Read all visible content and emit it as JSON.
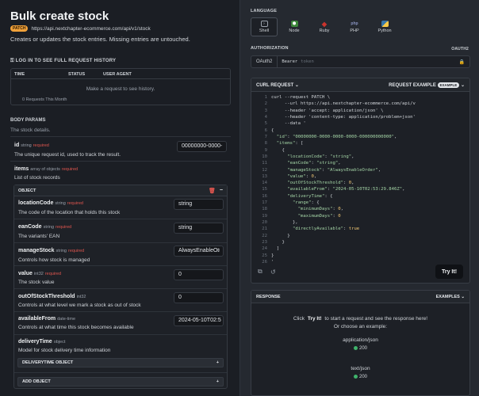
{
  "page": {
    "title": "Bulk create stock",
    "method": "PATCH",
    "url": "https://api.nextchapter-ecommerce.com/api/v1/stock",
    "description": "Creates or updates the stock entries. Missing entries are untouched."
  },
  "history": {
    "link_label": "LOG IN TO SEE FULL REQUEST HISTORY",
    "columns": [
      "TIME",
      "STATUS",
      "USER AGENT"
    ],
    "empty_message": "Make a request to see history.",
    "footer": "0 Requests This Month"
  },
  "body_params": {
    "label": "BODY PARAMS",
    "description": "The stock details.",
    "id": {
      "name": "id",
      "type": "string",
      "required": "required",
      "description": "The unique request id, used to track the result.",
      "value": "00000000-0000-"
    },
    "items": {
      "name": "items",
      "type": "array of objects",
      "required": "required",
      "description": "List of stock records",
      "object_label": "OBJECT",
      "fields": [
        {
          "name": "locationCode",
          "type": "string",
          "required": "required",
          "description": "The code of the location that holds this stock",
          "value": "string"
        },
        {
          "name": "eanCode",
          "type": "string",
          "required": "required",
          "description": "The variants' EAN",
          "value": "string"
        },
        {
          "name": "manageStock",
          "type": "string",
          "required": "required",
          "description": "Controls how stock is managed",
          "value": "AlwaysEnableO"
        },
        {
          "name": "value",
          "type": "int32",
          "required": "required",
          "description": "The stock value",
          "value": "0"
        },
        {
          "name": "outOfStockThreshold",
          "type": "int32",
          "required": "",
          "description": "Controls at what level we mark a stock as out of stock",
          "value": "0"
        },
        {
          "name": "availableFrom",
          "type": "date-time",
          "required": "",
          "description": "Controls at what time this stock becomes available",
          "value": "2024-05-10T02:5"
        },
        {
          "name": "deliveryTime",
          "type": "object",
          "required": "",
          "description": "Model for stock delivery time information",
          "value": ""
        }
      ],
      "delivery_object_label": "DELIVERYTIME OBJECT",
      "add_object_label": "ADD OBJECT",
      "plus": "+"
    }
  },
  "language": {
    "label": "LANGUAGE",
    "options": [
      {
        "label": "Shell",
        "icon": "shell-icon",
        "color": "#9aa1ab"
      },
      {
        "label": "Node",
        "icon": "node-icon",
        "color": "#6cc24a"
      },
      {
        "label": "Ruby",
        "icon": "ruby-icon",
        "color": "#cc342d"
      },
      {
        "label": "PHP",
        "icon": "php-icon",
        "color": "#8892bf"
      },
      {
        "label": "Python",
        "icon": "python-icon",
        "color": "#f7c948"
      }
    ]
  },
  "authorization": {
    "label": "AUTHORIZATION",
    "badge": "OAUTH2",
    "scheme": "OAuth2",
    "token_prefix": "Bearer",
    "token_placeholder": "token"
  },
  "request": {
    "curl_label": "CURL REQUEST",
    "example_label": "REQUEST EXAMPLE",
    "example_badge": "EXAMPLE",
    "lines": [
      "curl --request PATCH \\",
      "     --url https://api.nextchapter-ecommerce.com/api/v",
      "     --header 'accept: application/json' \\",
      "     --header 'content-type: application/problem+json'",
      "     --data '",
      "{",
      "  \"id\": \"00000000-0000-0000-0000-000000000000\",",
      "  \"items\": [",
      "    {",
      "      \"locationCode\": \"string\",",
      "      \"eanCode\": \"string\",",
      "      \"manageStock\": \"AlwaysEnableOrder\",",
      "      \"value\": 0,",
      "      \"outOfStockThreshold\": 0,",
      "      \"availableFrom\": \"2024-05-10T02:53:29.846Z\",",
      "      \"deliveryTime\": {",
      "        \"range\": {",
      "          \"minimumDays\": 0,",
      "          \"maximumDays\": 0",
      "        },",
      "        \"directlyAvailable\": true",
      "      }",
      "    }",
      "  ]",
      "}",
      "'"
    ],
    "try_label": "Try It!"
  },
  "response": {
    "label": "RESPONSE",
    "examples_label": "EXAMPLES",
    "prompt_pre": "Click",
    "prompt_btn": "Try It!",
    "prompt_post": "to start a request and see the response here!",
    "prompt_line2": "Or choose an example:",
    "examples": [
      {
        "type": "application/json",
        "status": "200"
      },
      {
        "type": "text/json",
        "status": "200"
      }
    ]
  }
}
